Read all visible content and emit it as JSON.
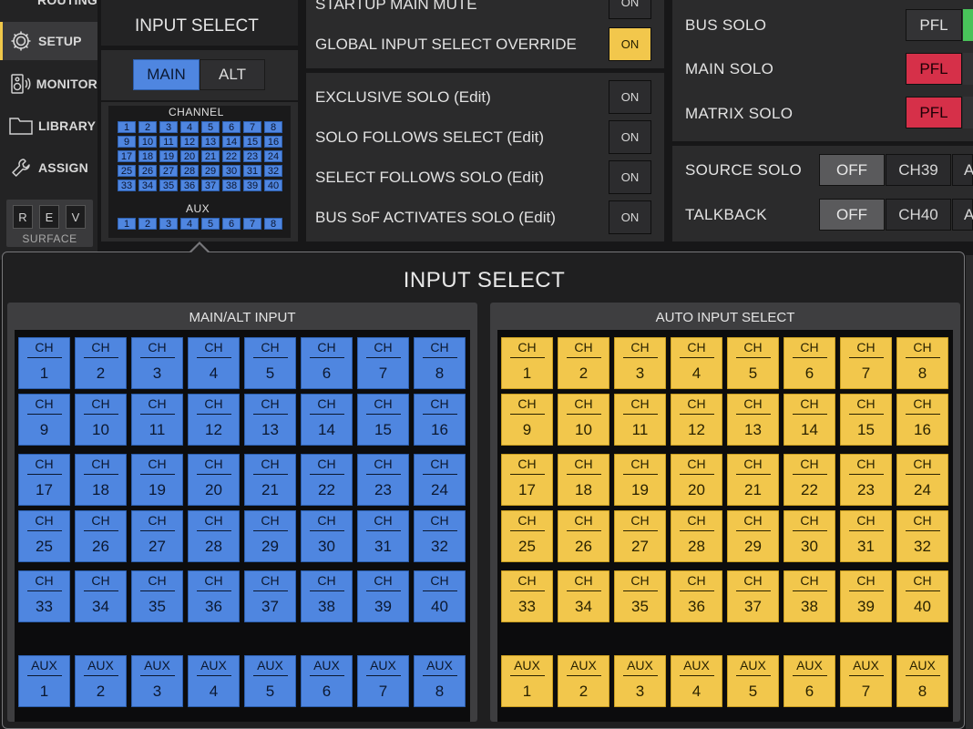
{
  "sidebar": {
    "routing_label": "ROUTING",
    "setup_label": "SETUP",
    "monitor_label": "MONITOR",
    "library_label": "LIBRARY",
    "assign_label": "ASSIGN",
    "surface": {
      "r": "R",
      "e": "E",
      "v": "V",
      "label": "SURFACE"
    },
    "active_color": "#f0c84a"
  },
  "input_select_panel": {
    "title": "INPUT SELECT",
    "main_label": "MAIN",
    "alt_label": "ALT",
    "channel_label": "CHANNEL",
    "aux_label": "AUX",
    "channels": [
      "1",
      "2",
      "3",
      "4",
      "5",
      "6",
      "7",
      "8",
      "9",
      "10",
      "11",
      "12",
      "13",
      "14",
      "15",
      "16",
      "17",
      "18",
      "19",
      "20",
      "21",
      "22",
      "23",
      "24",
      "25",
      "26",
      "27",
      "28",
      "29",
      "30",
      "31",
      "32",
      "33",
      "34",
      "35",
      "36",
      "37",
      "38",
      "39",
      "40"
    ],
    "aux": [
      "1",
      "2",
      "3",
      "4",
      "5",
      "6",
      "7",
      "8"
    ]
  },
  "options": {
    "startup_main_mute": {
      "label": "STARTUP MAIN MUTE",
      "state": "ON"
    },
    "global_override": {
      "label": "GLOBAL INPUT SELECT OVERRIDE",
      "state": "ON"
    },
    "exclusive_solo": {
      "label": "EXCLUSIVE SOLO (Edit)",
      "state": "ON"
    },
    "solo_follows_select": {
      "label": "SOLO FOLLOWS SELECT (Edit)",
      "state": "ON"
    },
    "select_follows_solo": {
      "label": "SELECT FOLLOWS SOLO (Edit)",
      "state": "ON"
    },
    "bus_sof": {
      "label": "BUS SoF ACTIVATES SOLO (Edit)",
      "state": "ON"
    }
  },
  "solo": {
    "bus_solo": {
      "label": "BUS SOLO",
      "value": "PFL"
    },
    "main_solo": {
      "label": "MAIN SOLO",
      "value": "PFL"
    },
    "matrix_solo": {
      "label": "MATRIX SOLO",
      "value": "PFL"
    },
    "source_solo": {
      "label": "SOURCE SOLO",
      "off": "OFF",
      "ch": "CH39",
      "more": "A"
    },
    "talkback": {
      "label": "TALKBACK",
      "off": "OFF",
      "ch": "CH40",
      "more": "A"
    }
  },
  "popup": {
    "title": "INPUT SELECT",
    "main_alt": {
      "title": "MAIN/ALT INPUT",
      "ch_prefix": "CH",
      "aux_prefix": "AUX",
      "color": "#4f86e0"
    },
    "auto": {
      "title": "AUTO INPUT SELECT",
      "ch_prefix": "CH",
      "aux_prefix": "AUX",
      "color": "#f2c74c"
    },
    "channels": [
      "1",
      "2",
      "3",
      "4",
      "5",
      "6",
      "7",
      "8",
      "9",
      "10",
      "11",
      "12",
      "13",
      "14",
      "15",
      "16",
      "17",
      "18",
      "19",
      "20",
      "21",
      "22",
      "23",
      "24",
      "25",
      "26",
      "27",
      "28",
      "29",
      "30",
      "31",
      "32",
      "33",
      "34",
      "35",
      "36",
      "37",
      "38",
      "39",
      "40"
    ],
    "aux": [
      "1",
      "2",
      "3",
      "4",
      "5",
      "6",
      "7",
      "8"
    ]
  }
}
